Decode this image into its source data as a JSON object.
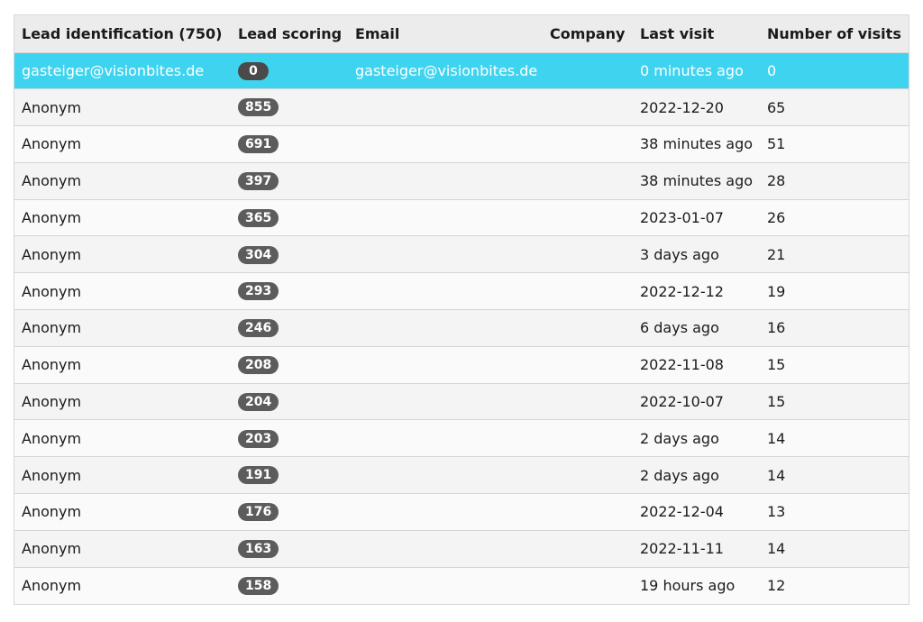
{
  "table": {
    "headers": {
      "lead": "Lead identification (750)",
      "score": "Lead scoring",
      "email": "Email",
      "company": "Company",
      "last_visit": "Last visit",
      "visits": "Number of visits"
    },
    "rows": [
      {
        "lead": "gasteiger@visionbites.de",
        "score": "0",
        "email": "gasteiger@visionbites.de",
        "company": "",
        "last_visit": "0 minutes ago",
        "visits": "0",
        "selected": true
      },
      {
        "lead": "Anonym",
        "score": "855",
        "email": "",
        "company": "",
        "last_visit": "2022-12-20",
        "visits": "65"
      },
      {
        "lead": "Anonym",
        "score": "691",
        "email": "",
        "company": "",
        "last_visit": "38 minutes ago",
        "visits": "51"
      },
      {
        "lead": "Anonym",
        "score": "397",
        "email": "",
        "company": "",
        "last_visit": "38 minutes ago",
        "visits": "28"
      },
      {
        "lead": "Anonym",
        "score": "365",
        "email": "",
        "company": "",
        "last_visit": "2023-01-07",
        "visits": "26"
      },
      {
        "lead": "Anonym",
        "score": "304",
        "email": "",
        "company": "",
        "last_visit": "3 days ago",
        "visits": "21"
      },
      {
        "lead": "Anonym",
        "score": "293",
        "email": "",
        "company": "",
        "last_visit": "2022-12-12",
        "visits": "19"
      },
      {
        "lead": "Anonym",
        "score": "246",
        "email": "",
        "company": "",
        "last_visit": "6 days ago",
        "visits": "16"
      },
      {
        "lead": "Anonym",
        "score": "208",
        "email": "",
        "company": "",
        "last_visit": "2022-11-08",
        "visits": "15"
      },
      {
        "lead": "Anonym",
        "score": "204",
        "email": "",
        "company": "",
        "last_visit": "2022-10-07",
        "visits": "15"
      },
      {
        "lead": "Anonym",
        "score": "203",
        "email": "",
        "company": "",
        "last_visit": "2 days ago",
        "visits": "14"
      },
      {
        "lead": "Anonym",
        "score": "191",
        "email": "",
        "company": "",
        "last_visit": "2 days ago",
        "visits": "14"
      },
      {
        "lead": "Anonym",
        "score": "176",
        "email": "",
        "company": "",
        "last_visit": "2022-12-04",
        "visits": "13"
      },
      {
        "lead": "Anonym",
        "score": "163",
        "email": "",
        "company": "",
        "last_visit": "2022-11-11",
        "visits": "14"
      },
      {
        "lead": "Anonym",
        "score": "158",
        "email": "",
        "company": "",
        "last_visit": "19 hours ago",
        "visits": "12"
      }
    ]
  },
  "colors": {
    "selected_row": "#3ed3ef",
    "header_bg": "#ececec",
    "badge_bg": "#5c5c5c"
  }
}
